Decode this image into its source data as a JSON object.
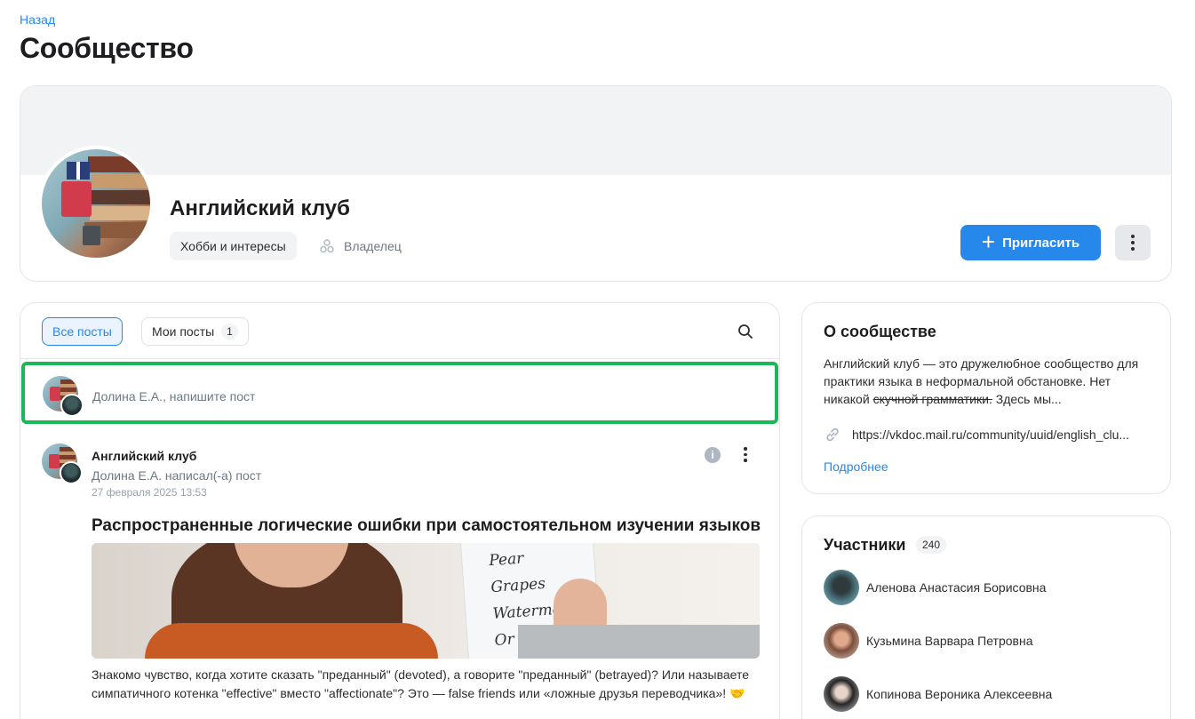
{
  "nav": {
    "back_label": "Назад"
  },
  "page": {
    "title": "Сообщество"
  },
  "community": {
    "name": "Английский клуб",
    "category": "Хобби и интересы",
    "role": "Владелец",
    "invite_label": "Пригласить"
  },
  "feed": {
    "tabs": [
      {
        "label": "Все посты"
      },
      {
        "label": "Мои посты",
        "count": "1"
      }
    ],
    "compose_placeholder": "Долина Е.А., напишите пост",
    "post": {
      "author": "Английский клуб",
      "subtitle": "Долина Е.А. написал(-а) пост",
      "date": "27 февраля 2025 13:53",
      "title": "Распространенные логические ошибки при самостоятельном изучении языков",
      "image_words": [
        "Pear",
        "Grapes",
        "Watermelo",
        "Or"
      ],
      "body": "Знакомо чувство, когда хотите сказать \"преданный\" (devoted), а говорите \"преданный\" (betrayed)? Или называете симпатичного котенка \"effective\" вместо \"affectionate\"? Это — false friends или «ложные друзья переводчика»! 🤝"
    }
  },
  "about": {
    "title": "О сообществе",
    "text_part1": "Английский клуб — это дружелюбное сообщество для практики языка в неформальной обстановке. Нет никакой ",
    "text_strike": "скучной грамматики.",
    "text_part2": " Здесь мы...",
    "link": "https://vkdoc.mail.ru/community/uuid/english_clu...",
    "more_label": "Подробнее"
  },
  "members": {
    "title": "Участники",
    "count": "240",
    "items": [
      {
        "name": "Аленова Анастасия Борисовна"
      },
      {
        "name": "Кузьмина Варвара Петровна"
      },
      {
        "name": "Копинова Вероника Алексеевна"
      }
    ]
  },
  "colors": {
    "accent": "#2688eb",
    "compose_border": "#19b95a"
  },
  "icons": [
    "search-icon",
    "plus-icon",
    "more-vertical-icon",
    "info-icon",
    "link-icon",
    "owner-icon"
  ]
}
